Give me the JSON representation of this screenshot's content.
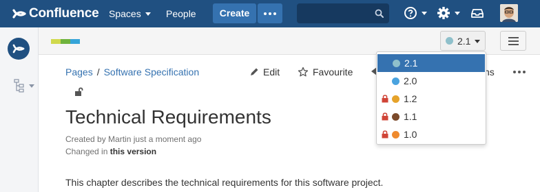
{
  "topnav": {
    "logo_text": "Confluence",
    "spaces_label": "Spaces",
    "people_label": "People",
    "create_label": "Create"
  },
  "subheader": {
    "colorbar": [
      "#d0d94c",
      "#6fb33c",
      "#35a4d8"
    ],
    "version_label": "2.1"
  },
  "breadcrumb": [
    "Pages",
    "Software Specification"
  ],
  "actions": {
    "edit_label": "Edit",
    "favourite_label": "Favourite",
    "partial_label": "ns"
  },
  "page": {
    "title": "Technical Requirements",
    "created_prefix": "Created by",
    "author": "Martin",
    "created_time": "just a moment ago",
    "changed_prefix": "Changed in",
    "changed_link": "this version",
    "body": "This chapter describes the technical requirements for this software project."
  },
  "versions": [
    {
      "label": "2.1",
      "color": "#8fc0cb",
      "locked": false,
      "selected": true
    },
    {
      "label": "2.0",
      "color": "#4aa3df",
      "locked": false,
      "selected": false
    },
    {
      "label": "1.2",
      "color": "#e6a32b",
      "locked": true,
      "selected": false
    },
    {
      "label": "1.1",
      "color": "#7b4a2b",
      "locked": true,
      "selected": false
    },
    {
      "label": "1.0",
      "color": "#ef8a2e",
      "locked": true,
      "selected": false
    }
  ],
  "colors": {
    "nav_bg": "#205081",
    "accent": "#3572b0",
    "lock_red": "#d04437"
  },
  "icons": [
    "confluence-logo-icon",
    "search-icon",
    "help-icon",
    "gear-icon",
    "notifications-icon",
    "space-logo-icon",
    "page-tree-icon",
    "unlock-icon",
    "pencil-icon",
    "star-icon",
    "share-icon",
    "more-icon",
    "hamburger-icon",
    "padlock-icon"
  ]
}
